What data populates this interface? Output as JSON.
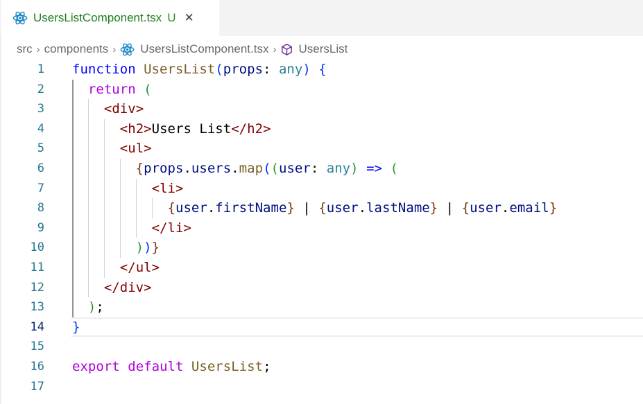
{
  "tab": {
    "icon": "react-icon",
    "filename": "UsersListComponent.tsx",
    "status": "U",
    "close": "✕"
  },
  "breadcrumb": {
    "items": [
      "src",
      "components",
      "UsersListComponent.tsx",
      "UsersList"
    ],
    "separator": "›"
  },
  "editor": {
    "active_line": 14,
    "lines": [
      {
        "n": "1"
      },
      {
        "n": "2"
      },
      {
        "n": "3"
      },
      {
        "n": "4"
      },
      {
        "n": "5"
      },
      {
        "n": "6"
      },
      {
        "n": "7"
      },
      {
        "n": "8"
      },
      {
        "n": "9"
      },
      {
        "n": "10"
      },
      {
        "n": "11"
      },
      {
        "n": "12"
      },
      {
        "n": "13"
      },
      {
        "n": "14"
      },
      {
        "n": "15"
      },
      {
        "n": "16"
      },
      {
        "n": "17"
      }
    ],
    "tokens": {
      "l1": [
        "function",
        " ",
        "UsersList",
        "(",
        "props",
        ": ",
        "any",
        ")",
        " ",
        "{"
      ],
      "l2": [
        "  ",
        "return",
        " ",
        "("
      ],
      "l3": [
        "    ",
        "<",
        "div",
        ">"
      ],
      "l4": [
        "      ",
        "<",
        "h2",
        ">",
        "Users List",
        "</",
        "h2",
        ">"
      ],
      "l5": [
        "      ",
        "<",
        "ul",
        ">"
      ],
      "l6": [
        "        ",
        "{",
        "props",
        ".",
        "users",
        ".",
        "map",
        "(",
        "(",
        "user",
        ": ",
        "any",
        ")",
        " ",
        "=>",
        " ",
        "("
      ],
      "l7": [
        "          ",
        "<",
        "li",
        ">"
      ],
      "l8": [
        "            ",
        "{",
        "user",
        ".",
        "firstName",
        "}",
        " | ",
        "{",
        "user",
        ".",
        "lastName",
        "}",
        " | ",
        "{",
        "user",
        ".",
        "email",
        "}"
      ],
      "l9": [
        "          ",
        "</",
        "li",
        ">"
      ],
      "l10": [
        "        ",
        ")",
        ")",
        "}"
      ],
      "l11": [
        "      ",
        "</",
        "ul",
        ">"
      ],
      "l12": [
        "    ",
        "</",
        "div",
        ">"
      ],
      "l13": [
        "  ",
        ")",
        ";"
      ],
      "l14": [
        "}"
      ],
      "l15": [
        ""
      ],
      "l16": [
        "export",
        " ",
        "default",
        " ",
        "UsersList",
        ";"
      ],
      "l17": [
        ""
      ]
    }
  }
}
